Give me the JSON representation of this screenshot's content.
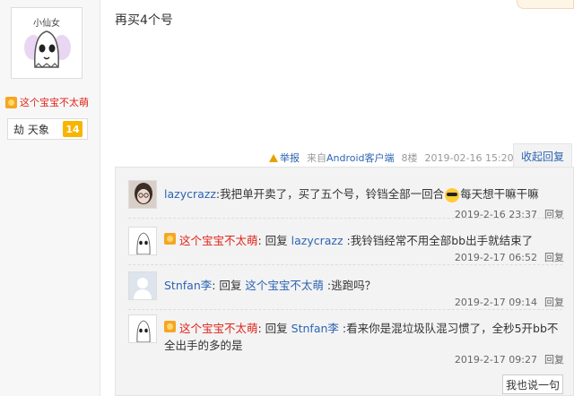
{
  "left": {
    "avatar_caption": "小仙女",
    "username": "这个宝宝不太萌",
    "level_name": "劫 天象",
    "level_value": "14"
  },
  "post": {
    "text": "再买4个号"
  },
  "meta": {
    "report": "举报",
    "source": "来自Android客户端",
    "floor": "8楼",
    "time": "2019-02-16 15:20",
    "collapse": "收起回复"
  },
  "replies": [
    {
      "name": "lazycrazz",
      "text_a": ":我把单开卖了，买了五个号，铃铛全部一回合",
      "text_b": "每天想干嘛干嘛",
      "time": "2019-2-16 23:37",
      "reply": "回复"
    },
    {
      "name": "这个宝宝不太萌",
      "prefix": ": 回复 ",
      "target": "lazycrazz",
      "text": " :我铃铛经常不用全部bb出手就结束了",
      "time": "2019-2-17 06:52",
      "reply": "回复"
    },
    {
      "name": "Stnfan李",
      "prefix": ": 回复 ",
      "target": "这个宝宝不太萌",
      "text": " :逃跑吗？",
      "time": "2019-2-17 09:14",
      "reply": "回复"
    },
    {
      "name": "这个宝宝不太萌",
      "prefix": ": 回复 ",
      "target": "Stnfan李",
      "text": " :看来你是混垃圾队混习惯了，全秒5开bb不全出手的多的是",
      "time": "2019-2-17 09:27",
      "reply": "回复"
    }
  ],
  "say_button": "我也说一句",
  "colors": {
    "link": "#2d64b3",
    "red_name": "#e0261d"
  }
}
